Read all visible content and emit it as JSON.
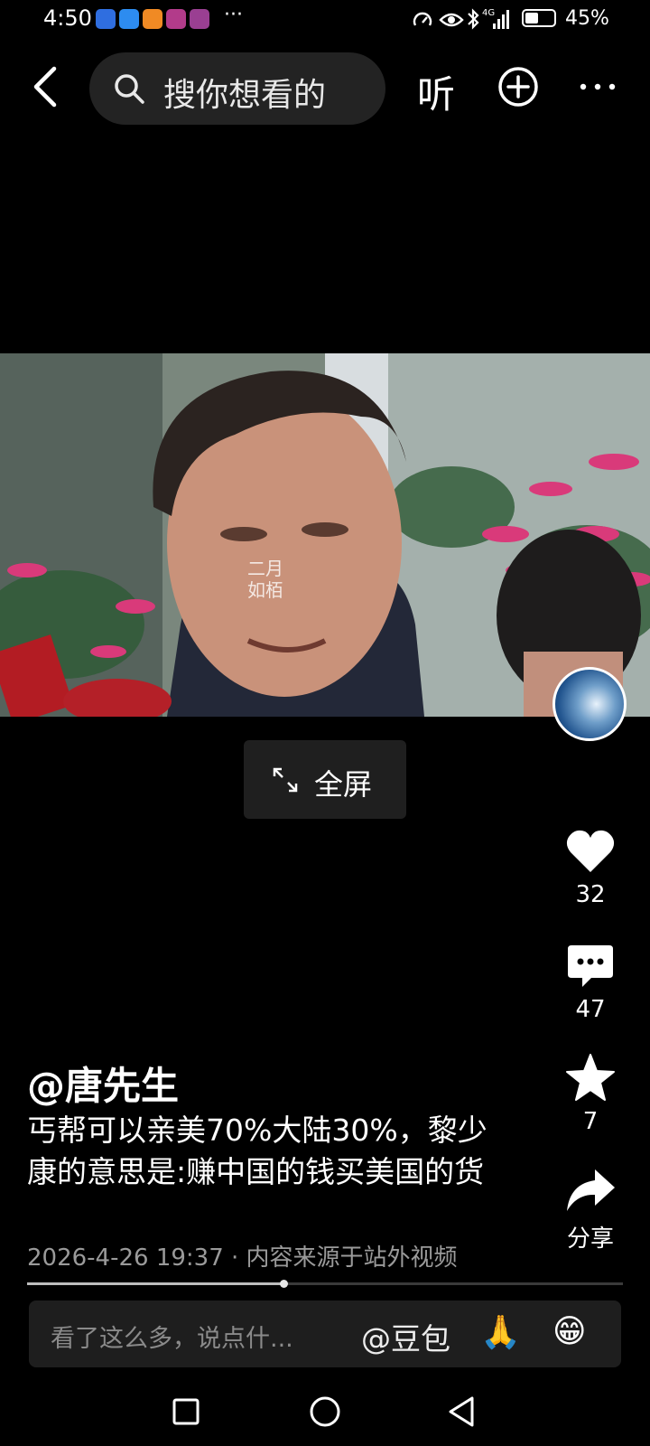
{
  "status_bar": {
    "time": "4:50",
    "more": "···",
    "network": "4G",
    "battery_level": 0.45,
    "battery_pct": "45%",
    "app_colors": [
      "#2f6ee0",
      "#2d8cf0",
      "#f08a24",
      "#b23b8a",
      "#9a3f92"
    ]
  },
  "top_bar": {
    "search_placeholder": "搜你想看的",
    "listen_label": "听"
  },
  "video": {
    "watermark": "二月\n如栢"
  },
  "fullscreen": {
    "label": "全屏"
  },
  "actions": {
    "like_count": "32",
    "comment_count": "47",
    "favorite_count": "7",
    "share_label": "分享"
  },
  "post": {
    "author": "@唐先生",
    "caption": "丐帮可以亲美70%大陆30%，黎少康的意思是:赚中国的钱买美国的货",
    "meta": "2026-4-26 19:37 · 内容来源于站外视频",
    "progress": 0.43
  },
  "comment_bar": {
    "placeholder": "看了这么多，说点什...",
    "mention": "@豆包",
    "emoji_1": "🙏",
    "emoji_2": "😁"
  }
}
